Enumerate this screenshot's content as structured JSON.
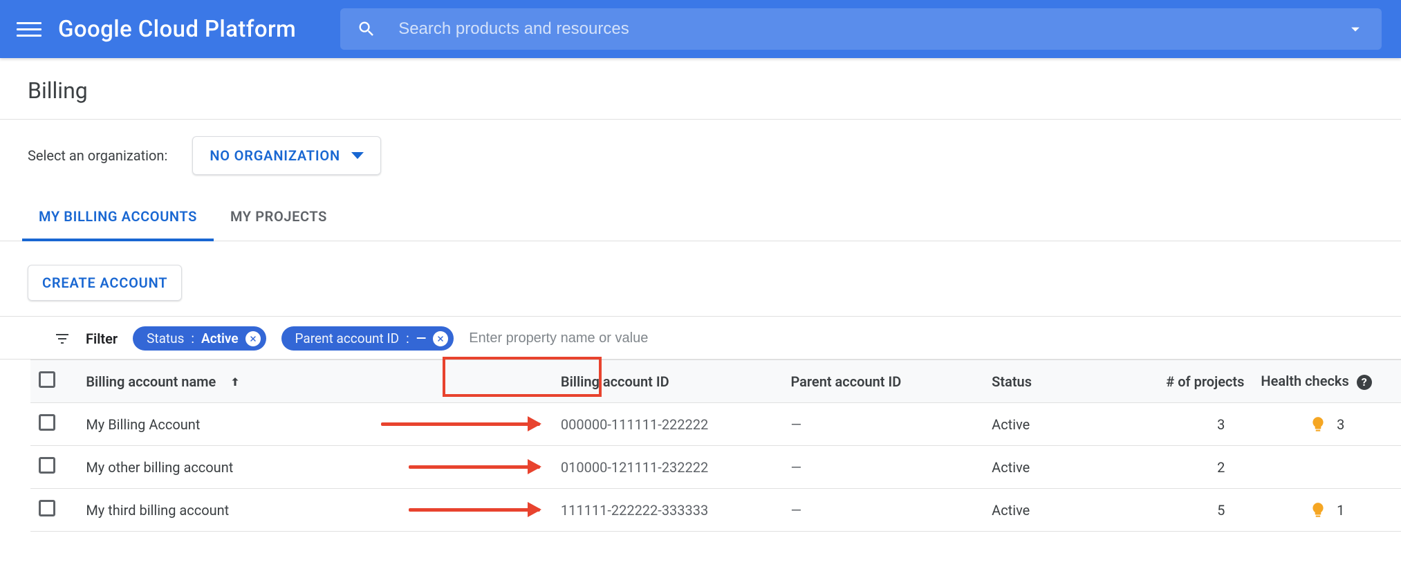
{
  "header": {
    "product_name": "Google Cloud Platform",
    "search_placeholder": "Search products and resources"
  },
  "page": {
    "title": "Billing",
    "org_label": "Select an organization:",
    "org_value": "NO ORGANIZATION"
  },
  "tabs": [
    {
      "id": "my-billing-accounts",
      "label": "MY BILLING ACCOUNTS",
      "active": true
    },
    {
      "id": "my-projects",
      "label": "MY PROJECTS",
      "active": false
    }
  ],
  "toolbar": {
    "create_label": "CREATE ACCOUNT"
  },
  "filter": {
    "label": "Filter",
    "chips": [
      {
        "key": "Status",
        "value": "Active"
      },
      {
        "key": "Parent account ID",
        "value": "—"
      }
    ],
    "input_placeholder": "Enter property name or value"
  },
  "table": {
    "columns": {
      "name": "Billing account name",
      "id": "Billing account ID",
      "parent": "Parent account ID",
      "status": "Status",
      "proj": "# of projects",
      "health": "Health checks"
    },
    "rows": [
      {
        "name": "My Billing Account",
        "id": "000000-111111-222222",
        "parent": "—",
        "status": "Active",
        "projects": "3",
        "health": "3"
      },
      {
        "name": "My other billing account",
        "id": "010000-121111-232222",
        "parent": "—",
        "status": "Active",
        "projects": "2",
        "health": ""
      },
      {
        "name": "My third billing account",
        "id": "111111-222222-333333",
        "parent": "—",
        "status": "Active",
        "projects": "5",
        "health": "1"
      }
    ]
  },
  "annotation": {
    "highlight_column": "Billing account ID",
    "arrows": "Red arrows point from each billing account name to its Billing account ID."
  }
}
